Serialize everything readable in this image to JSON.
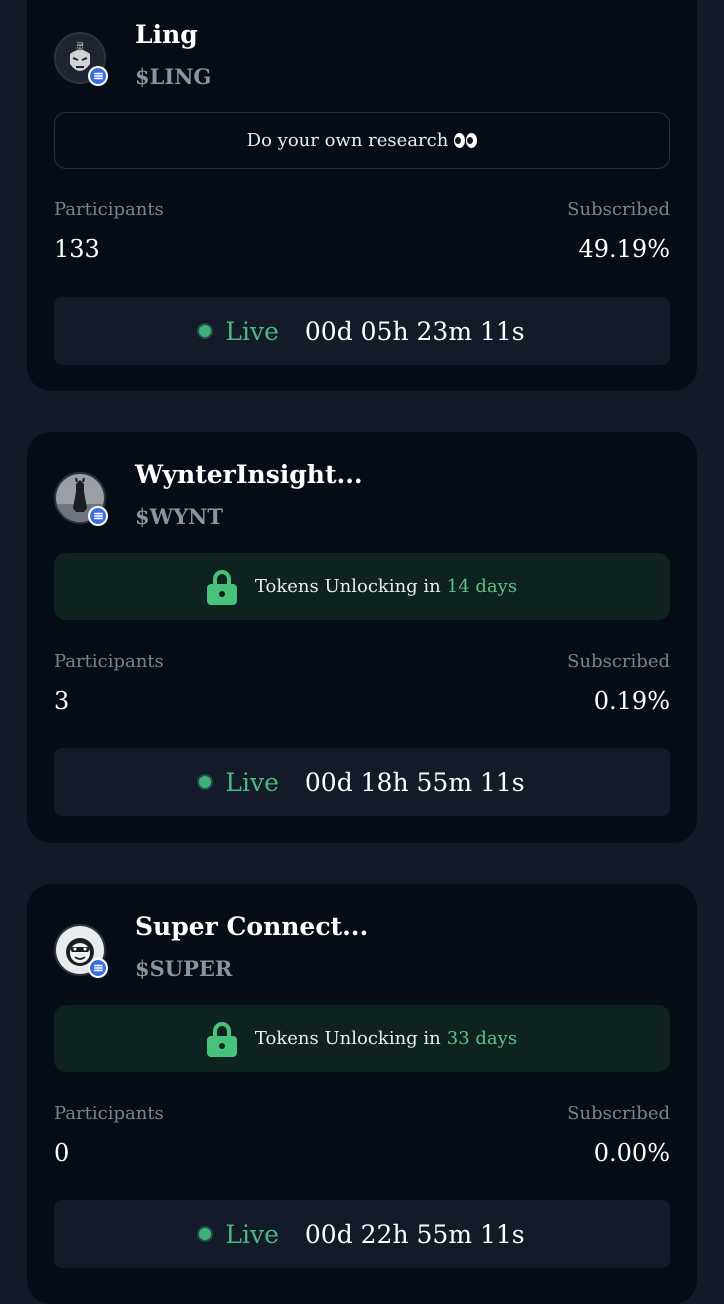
{
  "colors": {
    "background": "#121a28",
    "card": "#070d17",
    "accent_green": "#4cb97f",
    "unlock_bg": "#0e221f"
  },
  "cards": [
    {
      "name": "Ling",
      "ticker": "$LING",
      "notice": "Do your own research",
      "notice_icon": "eyes-emoji",
      "participants_label": "Participants",
      "participants": "133",
      "subscribed_label": "Subscribed",
      "subscribed": "49.19%",
      "status": "Live",
      "countdown": "00d 05h 23m 11s"
    },
    {
      "name": "WynterInsight...",
      "ticker": "$WYNT",
      "notice_prefix": "Tokens Unlocking in",
      "notice_days": "14 days",
      "participants_label": "Participants",
      "participants": "3",
      "subscribed_label": "Subscribed",
      "subscribed": "0.19%",
      "status": "Live",
      "countdown": "00d 18h 55m 11s"
    },
    {
      "name": "Super Connect...",
      "ticker": "$SUPER",
      "notice_prefix": "Tokens Unlocking in",
      "notice_days": "33 days",
      "participants_label": "Participants",
      "participants": "0",
      "subscribed_label": "Subscribed",
      "subscribed": "0.00%",
      "status": "Live",
      "countdown": "00d 22h 55m 11s"
    }
  ]
}
